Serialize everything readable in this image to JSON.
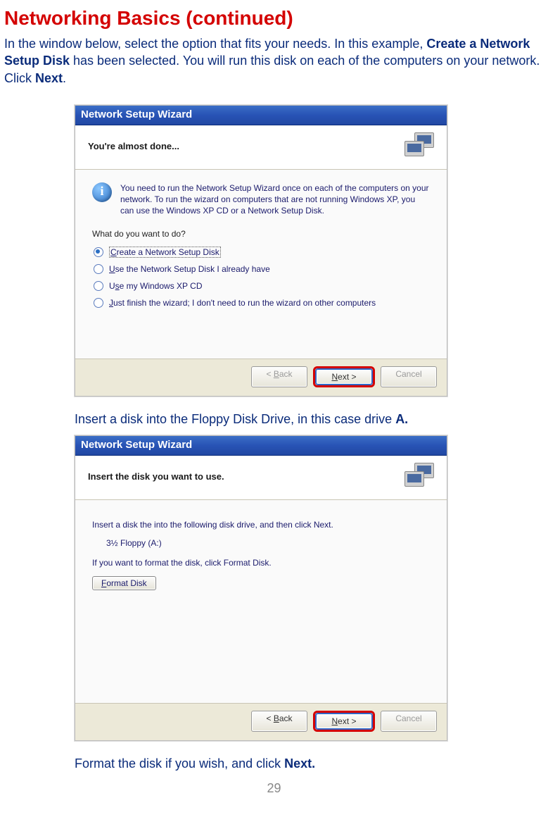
{
  "page": {
    "title": "Networking Basics (continued)",
    "intro_parts": [
      "In the window below, select the option that fits your needs.  In this example, ",
      "Create a Network Setup Disk",
      " has been selected.  You will run this disk on each of the computers on your network.  Click ",
      "Next",
      "."
    ],
    "caption1_parts": [
      "Insert a disk into the Floppy Disk Drive, in this case drive ",
      "A."
    ],
    "caption2_parts": [
      "Format the disk if you wish, and click ",
      "Next."
    ],
    "page_number": "29"
  },
  "wizard1": {
    "title": "Network Setup Wizard",
    "header": "You're almost done...",
    "info": "You need to run the Network Setup Wizard once on each of the computers on your network. To run the wizard on computers that are not running Windows XP, you can use the Windows XP CD or a Network Setup Disk.",
    "prompt": "What do you want to do?",
    "options": [
      {
        "pre": "",
        "u": "C",
        "rest": "reate a Network Setup Disk",
        "checked": true,
        "boxed": true
      },
      {
        "pre": "",
        "u": "U",
        "rest": "se the Network Setup Disk I already have",
        "checked": false,
        "boxed": false
      },
      {
        "pre": "U",
        "u": "s",
        "rest": "e my Windows XP CD",
        "checked": false,
        "boxed": false
      },
      {
        "pre": "",
        "u": "J",
        "rest": "ust finish the wizard; I don't need to run the wizard on other computers",
        "checked": false,
        "boxed": false
      }
    ],
    "buttons": {
      "back": "< Back",
      "next": "Next >",
      "next_u": "N",
      "next_rest": "ext >",
      "cancel": "Cancel",
      "back_u": "B",
      "back_pre": "< ",
      "back_rest": "ack"
    }
  },
  "wizard2": {
    "title": "Network Setup Wizard",
    "header": "Insert the disk you want to use.",
    "line1": "Insert a disk the into the following disk drive, and then click Next.",
    "drive": "3½ Floppy (A:)",
    "line2": "If you want to format the disk, click Format Disk.",
    "format_btn_u": "F",
    "format_btn_rest": "ormat Disk",
    "buttons": {
      "back_pre": "< ",
      "back_u": "B",
      "back_rest": "ack",
      "next_u": "N",
      "next_rest": "ext >",
      "cancel": "Cancel"
    }
  }
}
